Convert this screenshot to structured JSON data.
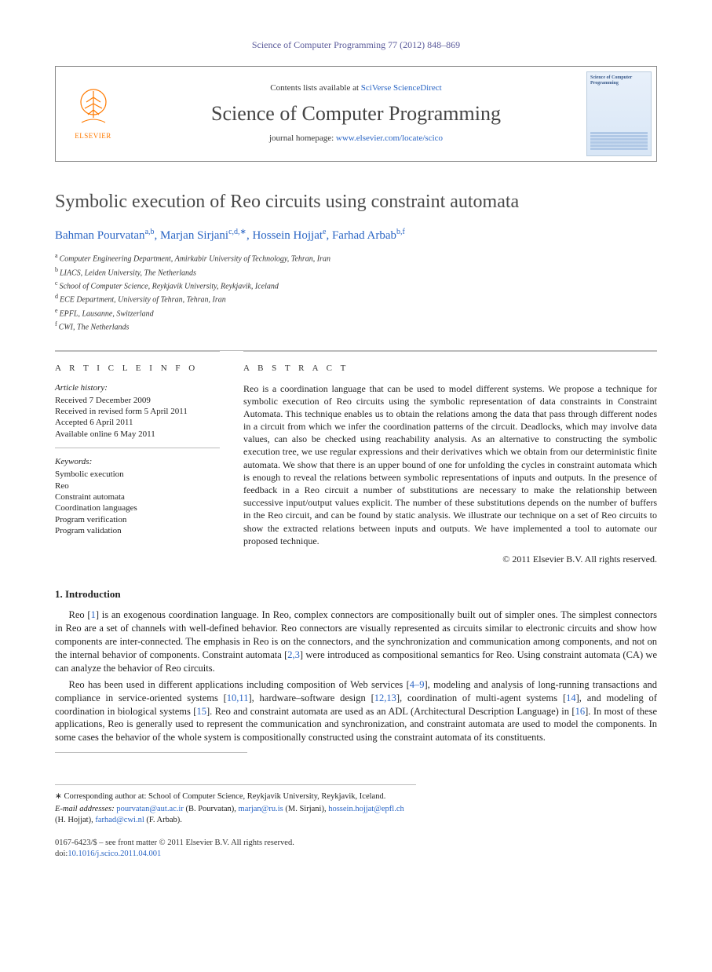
{
  "citation": "Science of Computer Programming 77 (2012) 848–869",
  "header": {
    "contents_prefix": "Contents lists available at ",
    "contents_link": "SciVerse ScienceDirect",
    "journal": "Science of Computer Programming",
    "homepage_prefix": "journal homepage: ",
    "homepage_link": "www.elsevier.com/locate/scico",
    "logo_text": "ELSEVIER",
    "cover_title": "Science of Computer Programming"
  },
  "title": "Symbolic execution of Reo circuits using constraint automata",
  "authors": [
    {
      "name": "Bahman Pourvatan",
      "sup": "a,b"
    },
    {
      "name": "Marjan Sirjani",
      "sup": "c,d,",
      "corresponding": true
    },
    {
      "name": "Hossein Hojjat",
      "sup": "e"
    },
    {
      "name": "Farhad Arbab",
      "sup": "b,f"
    }
  ],
  "affiliations": [
    {
      "key": "a",
      "text": "Computer Engineering Department, Amirkabir University of Technology, Tehran, Iran"
    },
    {
      "key": "b",
      "text": "LIACS, Leiden University, The Netherlands"
    },
    {
      "key": "c",
      "text": "School of Computer Science, Reykjavik University, Reykjavik, Iceland"
    },
    {
      "key": "d",
      "text": "ECE Department, University of Tehran, Tehran, Iran"
    },
    {
      "key": "e",
      "text": "EPFL, Lausanne, Switzerland"
    },
    {
      "key": "f",
      "text": "CWI, The Netherlands"
    }
  ],
  "info": {
    "heading": "a r t i c l e   i n f o",
    "history_label": "Article history:",
    "history": [
      "Received 7 December 2009",
      "Received in revised form 5 April 2011",
      "Accepted 6 April 2011",
      "Available online 6 May 2011"
    ],
    "keywords_label": "Keywords:",
    "keywords": [
      "Symbolic execution",
      "Reo",
      "Constraint automata",
      "Coordination languages",
      "Program verification",
      "Program validation"
    ]
  },
  "abstract": {
    "heading": "a b s t r a c t",
    "text": "Reo is a coordination language that can be used to model different systems. We propose a technique for symbolic execution of Reo circuits using the symbolic representation of data constraints in Constraint Automata. This technique enables us to obtain the relations among the data that pass through different nodes in a circuit from which we infer the coordination patterns of the circuit. Deadlocks, which may involve data values, can also be checked using reachability analysis. As an alternative to constructing the symbolic execution tree, we use regular expressions and their derivatives which we obtain from our deterministic finite automata. We show that there is an upper bound of one for unfolding the cycles in constraint automata which is enough to reveal the relations between symbolic representations of inputs and outputs. In the presence of feedback in a Reo circuit a number of substitutions are necessary to make the relationship between successive input/output values explicit. The number of these substitutions depends on the number of buffers in the Reo circuit, and can be found by static analysis. We illustrate our technique on a set of Reo circuits to show the extracted relations between inputs and outputs. We have implemented a tool to automate our proposed technique.",
    "copyright": "© 2011 Elsevier B.V. All rights reserved."
  },
  "intro": {
    "heading": "1.  Introduction",
    "p1_pre": "Reo [",
    "p1_ref1": "1",
    "p1_mid1": "] is an exogenous coordination language. In Reo, complex connectors are compositionally built out of simpler ones. The simplest connectors in Reo are a set of channels with well-defined behavior. Reo connectors are visually represented as circuits similar to electronic circuits and show how components are inter-connected. The emphasis in Reo is on the connectors, and the synchronization and communication among components, and not on the internal behavior of components. Constraint automata [",
    "p1_ref2": "2,3",
    "p1_post": "] were introduced as compositional semantics for Reo. Using constraint automata (CA) we can analyze the behavior of Reo circuits.",
    "p2_pre": "Reo has been used in different applications including composition of Web services [",
    "p2_ref1": "4–9",
    "p2_mid1": "], modeling and analysis of long-running transactions and compliance in service-oriented systems [",
    "p2_ref2": "10,11",
    "p2_mid2": "], hardware–software design [",
    "p2_ref3": "12,13",
    "p2_mid3": "], coordination of multi-agent systems [",
    "p2_ref4": "14",
    "p2_mid4": "], and modeling of coordination in biological systems [",
    "p2_ref5": "15",
    "p2_mid5": "]. Reo and constraint automata are used as an ADL (Architectural Description Language) in [",
    "p2_ref6": "16",
    "p2_post": "]. In most of these applications, Reo is generally used to represent the communication and synchronization, and constraint automata are used to model the components. In some cases the behavior of the whole system is compositionally constructed using the constraint automata of its constituents."
  },
  "footnote": {
    "corr_label": "∗",
    "corr_text": "Corresponding author at: School of Computer Science, Reykjavik University, Reykjavik, Iceland.",
    "email_label": "E-mail addresses:",
    "emails": [
      {
        "addr": "pourvatan@aut.ac.ir",
        "who": "(B. Pourvatan)"
      },
      {
        "addr": "marjan@ru.is",
        "who": "(M. Sirjani)"
      },
      {
        "addr": "hossein.hojjat@epfl.ch",
        "who": "(H. Hojjat)"
      },
      {
        "addr": "farhad@cwi.nl",
        "who": "(F. Arbab)"
      }
    ]
  },
  "bottom": {
    "issn_line": "0167-6423/$ – see front matter © 2011 Elsevier B.V. All rights reserved.",
    "doi_label": "doi:",
    "doi": "10.1016/j.scico.2011.04.001"
  }
}
